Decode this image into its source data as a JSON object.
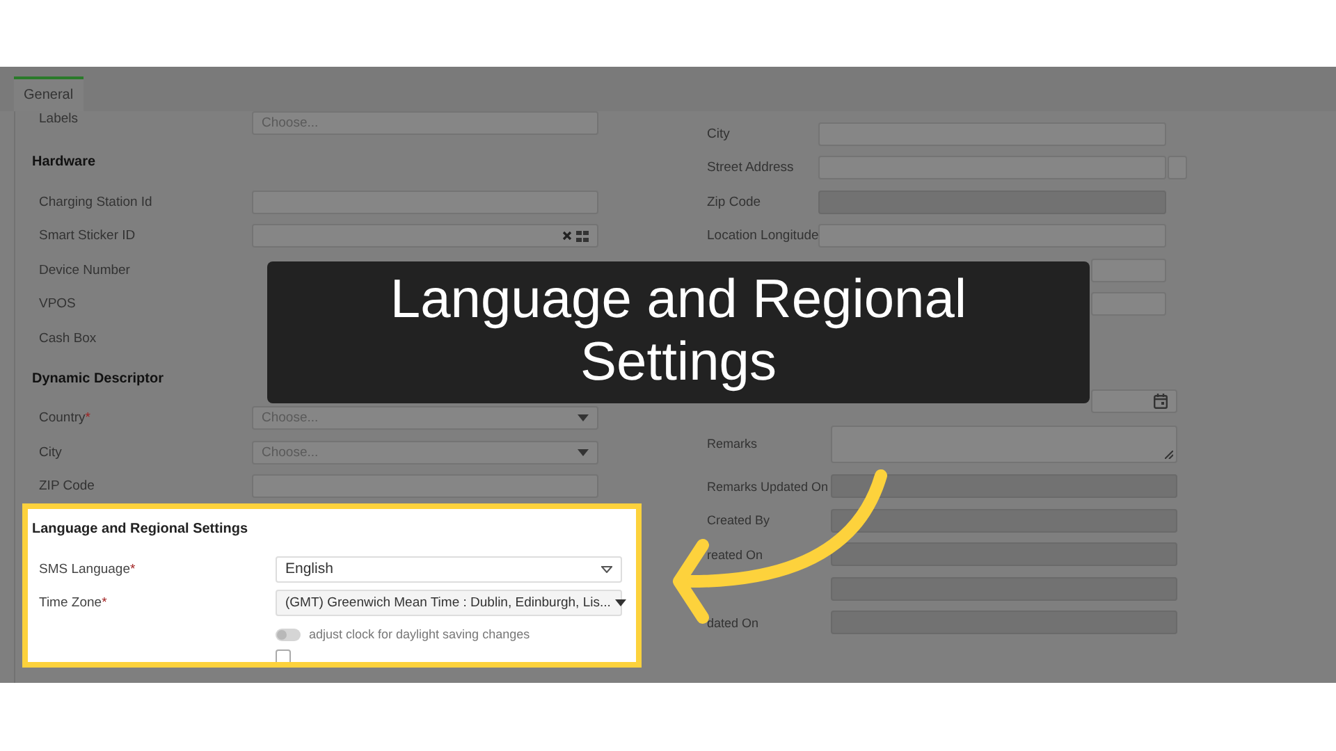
{
  "tabs": [
    {
      "label": "General",
      "selected": true
    }
  ],
  "left_column": [
    {
      "kind": "text",
      "label": "Labels",
      "placeholder": "Choose..."
    },
    {
      "kind": "heading",
      "label": "Hardware"
    },
    {
      "kind": "text",
      "label": "Charging Station Id"
    },
    {
      "kind": "lookup",
      "label": "Smart Sticker ID"
    },
    {
      "kind": "none",
      "label": "Device Number"
    },
    {
      "kind": "none",
      "label": "VPOS"
    },
    {
      "kind": "none",
      "label": "Cash Box"
    },
    {
      "kind": "heading",
      "label": "Dynamic Descriptor"
    },
    {
      "kind": "select",
      "label": "Country",
      "mark": "*",
      "placeholder": "Choose..."
    },
    {
      "kind": "select",
      "label": "City",
      "placeholder": "Choose..."
    },
    {
      "kind": "text",
      "label": "ZIP Code"
    }
  ],
  "highlighted_section": {
    "title": "Language and Regional Settings",
    "rows": [
      {
        "kind": "dropdown",
        "label": "SMS Language",
        "mark": "*",
        "value": "English"
      },
      {
        "kind": "select",
        "label": "Time Zone",
        "mark": "*",
        "value": "(GMT) Greenwich Mean Time : Dublin, Edinburgh, Lis..."
      }
    ],
    "toggle": {
      "label": "adjust clock for daylight saving changes",
      "on": false
    },
    "checkbox": {
      "checked": false
    }
  },
  "right_column": [
    [
      {
        "kind": "text",
        "label": "City"
      },
      {
        "kind": "split",
        "label": "Street Address"
      },
      {
        "kind": "text",
        "label": "Zip Code",
        "disabled": true
      },
      {
        "kind": "text",
        "label": "Location Longitude"
      },
      {
        "kind": "text"
      },
      {
        "kind": "text"
      }
    ],
    [
      {
        "kind": "date"
      },
      {
        "kind": "textarea",
        "label": "Remarks"
      },
      {
        "kind": "text",
        "label": "Remarks Updated On",
        "disabled": true
      },
      {
        "kind": "text",
        "label": "Created By",
        "disabled": true
      },
      {
        "kind": "text",
        "label": "reated On",
        "disabled": true
      },
      {
        "kind": "text",
        "disabled": true
      },
      {
        "kind": "text",
        "label": "dated On",
        "disabled": true
      }
    ]
  ],
  "banner": {
    "text": "Language and Regional Settings"
  }
}
